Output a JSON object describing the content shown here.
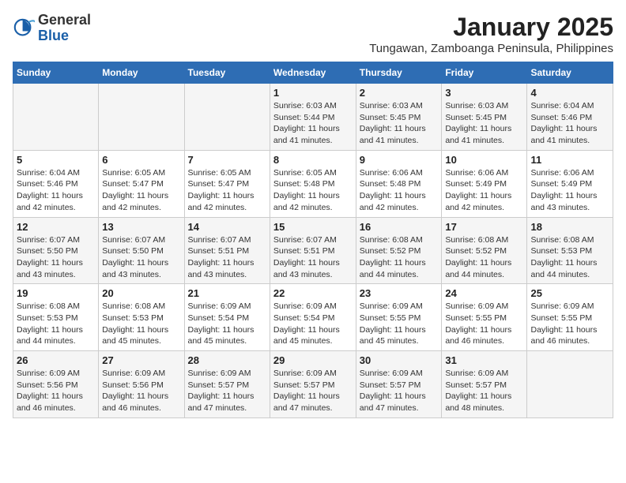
{
  "header": {
    "logo_general": "General",
    "logo_blue": "Blue",
    "month_title": "January 2025",
    "subtitle": "Tungawan, Zamboanga Peninsula, Philippines"
  },
  "days_of_week": [
    "Sunday",
    "Monday",
    "Tuesday",
    "Wednesday",
    "Thursday",
    "Friday",
    "Saturday"
  ],
  "weeks": [
    [
      {
        "day": "",
        "info": ""
      },
      {
        "day": "",
        "info": ""
      },
      {
        "day": "",
        "info": ""
      },
      {
        "day": "1",
        "info": "Sunrise: 6:03 AM\nSunset: 5:44 PM\nDaylight: 11 hours and 41 minutes."
      },
      {
        "day": "2",
        "info": "Sunrise: 6:03 AM\nSunset: 5:45 PM\nDaylight: 11 hours and 41 minutes."
      },
      {
        "day": "3",
        "info": "Sunrise: 6:03 AM\nSunset: 5:45 PM\nDaylight: 11 hours and 41 minutes."
      },
      {
        "day": "4",
        "info": "Sunrise: 6:04 AM\nSunset: 5:46 PM\nDaylight: 11 hours and 41 minutes."
      }
    ],
    [
      {
        "day": "5",
        "info": "Sunrise: 6:04 AM\nSunset: 5:46 PM\nDaylight: 11 hours and 42 minutes."
      },
      {
        "day": "6",
        "info": "Sunrise: 6:05 AM\nSunset: 5:47 PM\nDaylight: 11 hours and 42 minutes."
      },
      {
        "day": "7",
        "info": "Sunrise: 6:05 AM\nSunset: 5:47 PM\nDaylight: 11 hours and 42 minutes."
      },
      {
        "day": "8",
        "info": "Sunrise: 6:05 AM\nSunset: 5:48 PM\nDaylight: 11 hours and 42 minutes."
      },
      {
        "day": "9",
        "info": "Sunrise: 6:06 AM\nSunset: 5:48 PM\nDaylight: 11 hours and 42 minutes."
      },
      {
        "day": "10",
        "info": "Sunrise: 6:06 AM\nSunset: 5:49 PM\nDaylight: 11 hours and 42 minutes."
      },
      {
        "day": "11",
        "info": "Sunrise: 6:06 AM\nSunset: 5:49 PM\nDaylight: 11 hours and 43 minutes."
      }
    ],
    [
      {
        "day": "12",
        "info": "Sunrise: 6:07 AM\nSunset: 5:50 PM\nDaylight: 11 hours and 43 minutes."
      },
      {
        "day": "13",
        "info": "Sunrise: 6:07 AM\nSunset: 5:50 PM\nDaylight: 11 hours and 43 minutes."
      },
      {
        "day": "14",
        "info": "Sunrise: 6:07 AM\nSunset: 5:51 PM\nDaylight: 11 hours and 43 minutes."
      },
      {
        "day": "15",
        "info": "Sunrise: 6:07 AM\nSunset: 5:51 PM\nDaylight: 11 hours and 43 minutes."
      },
      {
        "day": "16",
        "info": "Sunrise: 6:08 AM\nSunset: 5:52 PM\nDaylight: 11 hours and 44 minutes."
      },
      {
        "day": "17",
        "info": "Sunrise: 6:08 AM\nSunset: 5:52 PM\nDaylight: 11 hours and 44 minutes."
      },
      {
        "day": "18",
        "info": "Sunrise: 6:08 AM\nSunset: 5:53 PM\nDaylight: 11 hours and 44 minutes."
      }
    ],
    [
      {
        "day": "19",
        "info": "Sunrise: 6:08 AM\nSunset: 5:53 PM\nDaylight: 11 hours and 44 minutes."
      },
      {
        "day": "20",
        "info": "Sunrise: 6:08 AM\nSunset: 5:53 PM\nDaylight: 11 hours and 45 minutes."
      },
      {
        "day": "21",
        "info": "Sunrise: 6:09 AM\nSunset: 5:54 PM\nDaylight: 11 hours and 45 minutes."
      },
      {
        "day": "22",
        "info": "Sunrise: 6:09 AM\nSunset: 5:54 PM\nDaylight: 11 hours and 45 minutes."
      },
      {
        "day": "23",
        "info": "Sunrise: 6:09 AM\nSunset: 5:55 PM\nDaylight: 11 hours and 45 minutes."
      },
      {
        "day": "24",
        "info": "Sunrise: 6:09 AM\nSunset: 5:55 PM\nDaylight: 11 hours and 46 minutes."
      },
      {
        "day": "25",
        "info": "Sunrise: 6:09 AM\nSunset: 5:55 PM\nDaylight: 11 hours and 46 minutes."
      }
    ],
    [
      {
        "day": "26",
        "info": "Sunrise: 6:09 AM\nSunset: 5:56 PM\nDaylight: 11 hours and 46 minutes."
      },
      {
        "day": "27",
        "info": "Sunrise: 6:09 AM\nSunset: 5:56 PM\nDaylight: 11 hours and 46 minutes."
      },
      {
        "day": "28",
        "info": "Sunrise: 6:09 AM\nSunset: 5:57 PM\nDaylight: 11 hours and 47 minutes."
      },
      {
        "day": "29",
        "info": "Sunrise: 6:09 AM\nSunset: 5:57 PM\nDaylight: 11 hours and 47 minutes."
      },
      {
        "day": "30",
        "info": "Sunrise: 6:09 AM\nSunset: 5:57 PM\nDaylight: 11 hours and 47 minutes."
      },
      {
        "day": "31",
        "info": "Sunrise: 6:09 AM\nSunset: 5:57 PM\nDaylight: 11 hours and 48 minutes."
      },
      {
        "day": "",
        "info": ""
      }
    ]
  ]
}
